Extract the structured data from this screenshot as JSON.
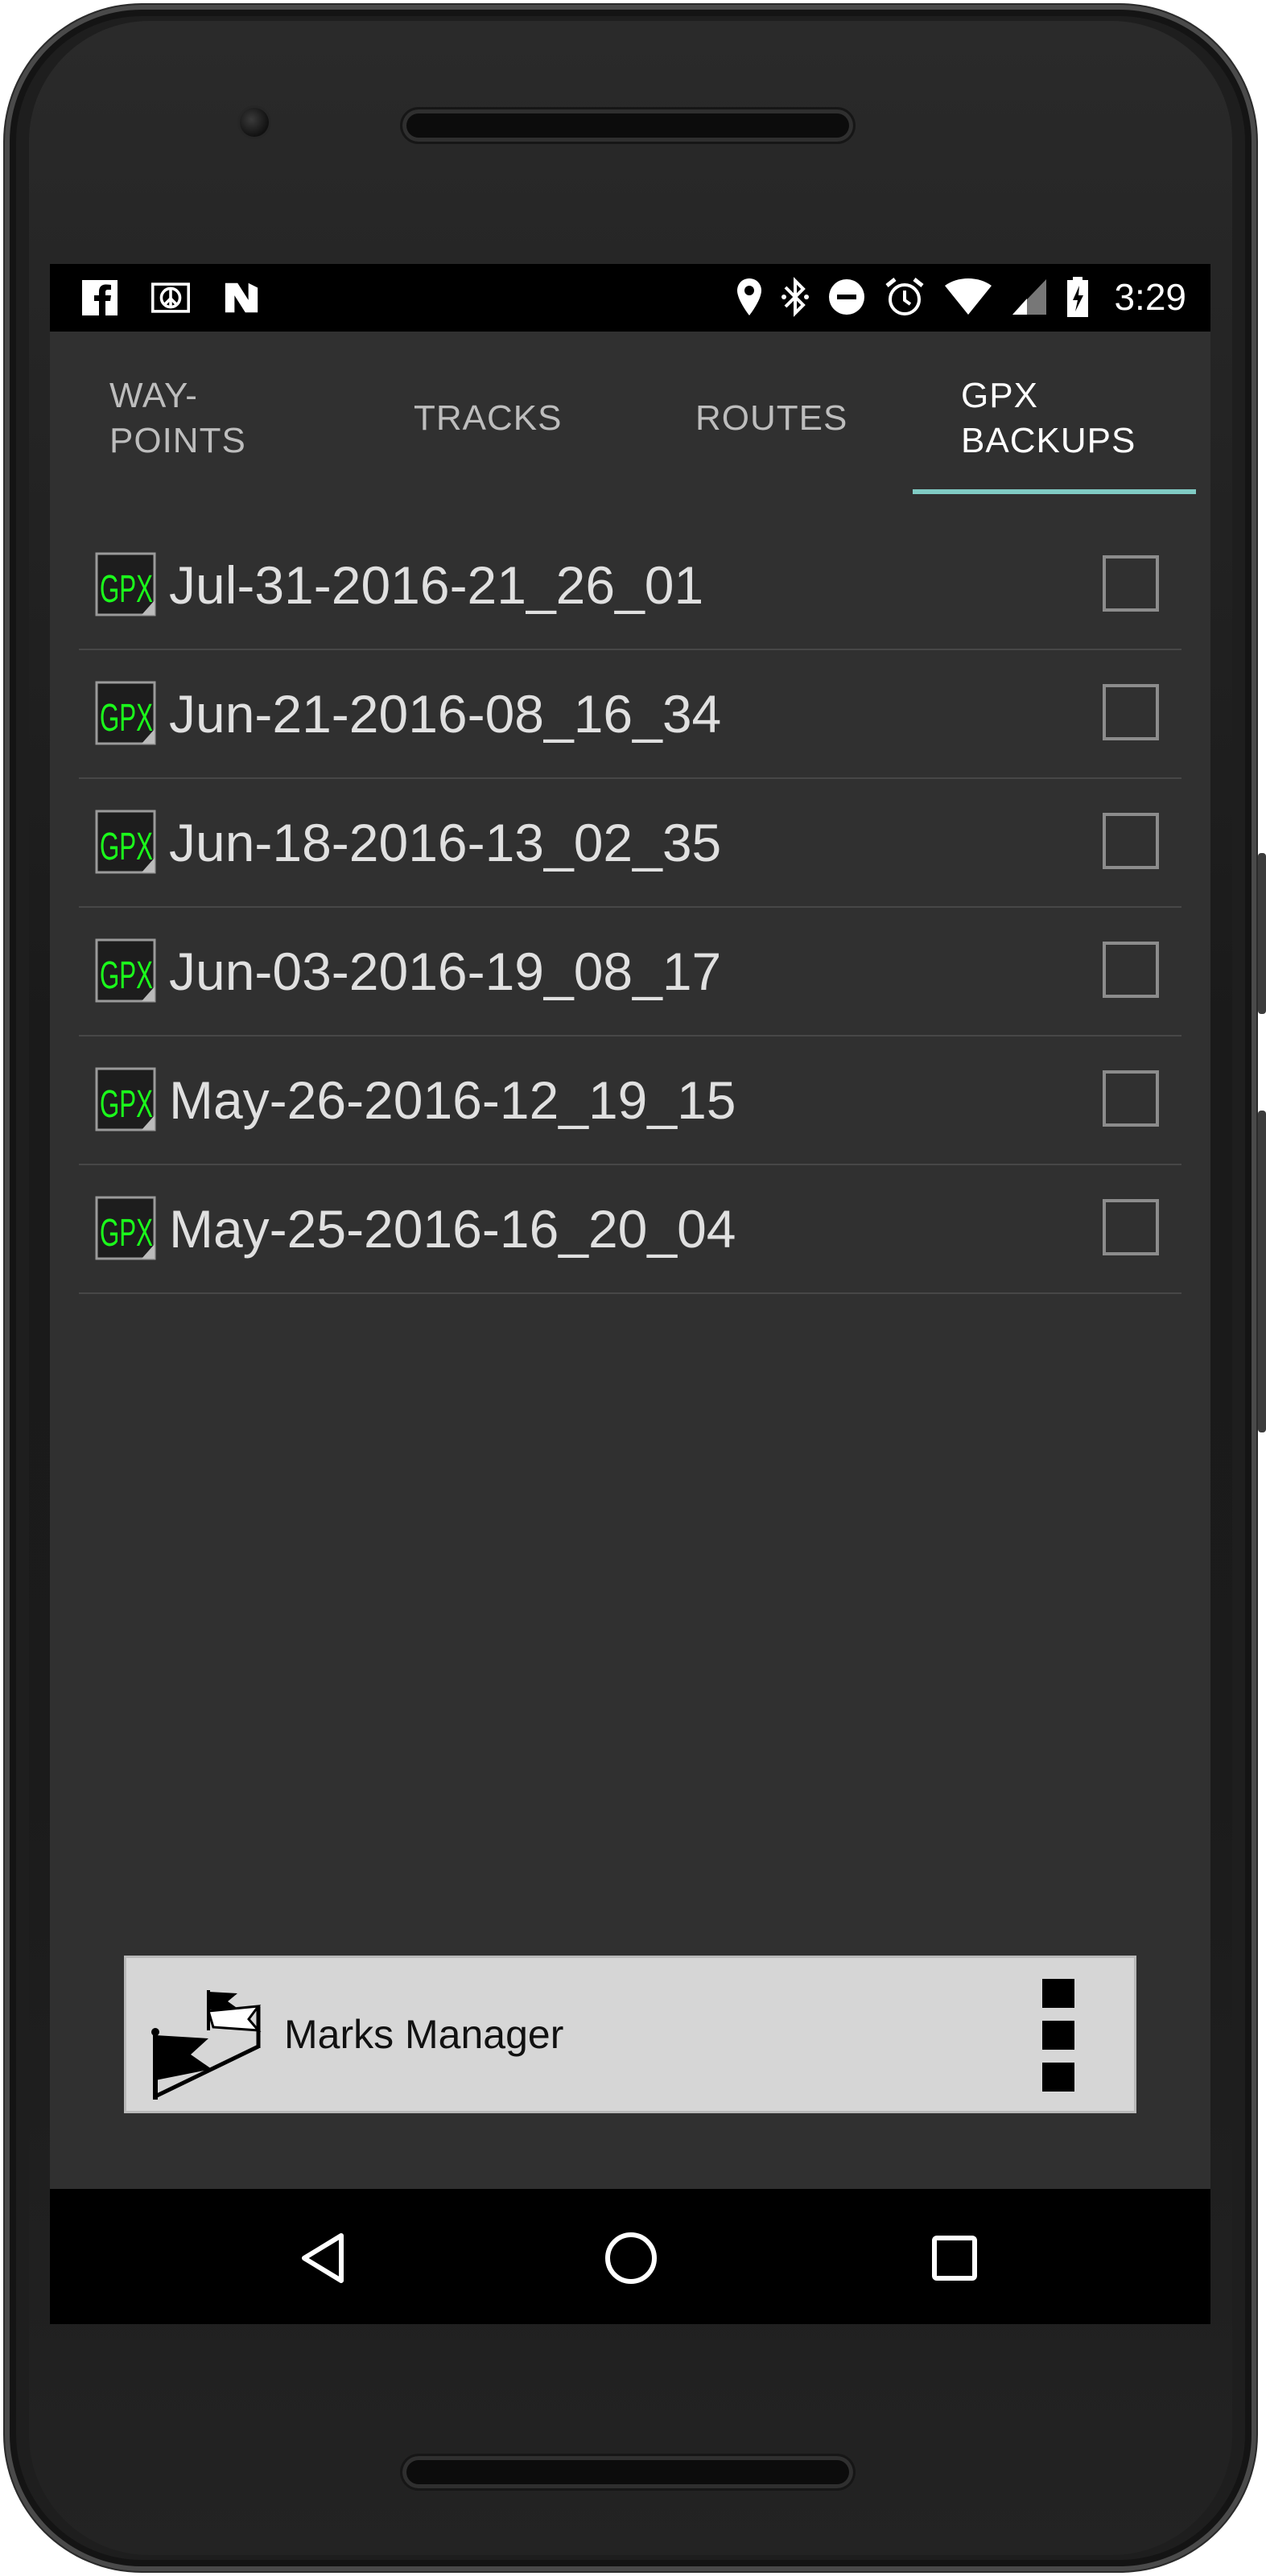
{
  "status_bar": {
    "time": "3:29",
    "left_icons": [
      "facebook-icon",
      "peace-icon",
      "n-app-icon"
    ],
    "right_icons": [
      "location-icon",
      "bluetooth-icon",
      "do-not-disturb-icon",
      "alarm-icon",
      "wifi-icon",
      "cell-signal-icon",
      "battery-charging-icon"
    ]
  },
  "tabs": [
    {
      "label_line1": "WAY-",
      "label_line2": "POINTS",
      "active": false
    },
    {
      "label_line1": "TRACKS",
      "label_line2": "",
      "active": false
    },
    {
      "label_line1": "ROUTES",
      "label_line2": "",
      "active": false
    },
    {
      "label_line1": "GPX",
      "label_line2": "BACKUPS",
      "active": true
    }
  ],
  "accent_color": "#80cbc4",
  "backups": [
    {
      "name": "Jul-31-2016-21_26_01",
      "checked": false
    },
    {
      "name": "Jun-21-2016-08_16_34",
      "checked": false
    },
    {
      "name": "Jun-18-2016-13_02_35",
      "checked": false
    },
    {
      "name": "Jun-03-2016-19_08_17",
      "checked": false
    },
    {
      "name": "May-26-2016-12_19_15",
      "checked": false
    },
    {
      "name": "May-25-2016-16_20_04",
      "checked": false
    }
  ],
  "bottom_bar": {
    "title": "Marks Manager",
    "logo_icon": "flags-icon",
    "menu_icon": "overflow-menu-icon"
  },
  "nav_bar": [
    "back-icon",
    "home-icon",
    "recents-icon"
  ]
}
